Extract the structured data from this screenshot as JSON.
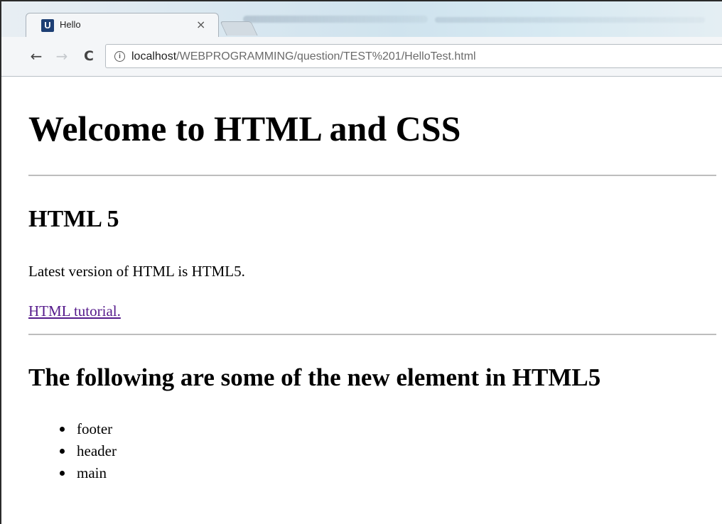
{
  "browser": {
    "tab": {
      "title": "Hello",
      "favicon_letter": "U",
      "close_glyph": "×"
    },
    "nav": {
      "back_glyph": "←",
      "forward_glyph": "→",
      "reload_glyph": "C"
    },
    "address": {
      "info_glyph": "i",
      "host": "localhost",
      "path": "/WEBPROGRAMMING/question/TEST%201/HelloTest.html"
    }
  },
  "page": {
    "heading": "Welcome to HTML and CSS",
    "section1": {
      "heading": "HTML 5",
      "paragraph": "Latest version of HTML is HTML5.",
      "link_text": "HTML tutorial."
    },
    "section2": {
      "heading": "The following are some of the new element in HTML5",
      "items": [
        "footer",
        "header",
        "main"
      ]
    }
  },
  "colors": {
    "link_visited": "#551a8b",
    "rule": "#bdbdbd",
    "favicon_bg": "#1d3f74"
  },
  "icons": {
    "back": "arrow-left-icon",
    "forward": "arrow-right-icon",
    "reload": "reload-icon",
    "info": "info-icon",
    "close": "close-icon"
  }
}
